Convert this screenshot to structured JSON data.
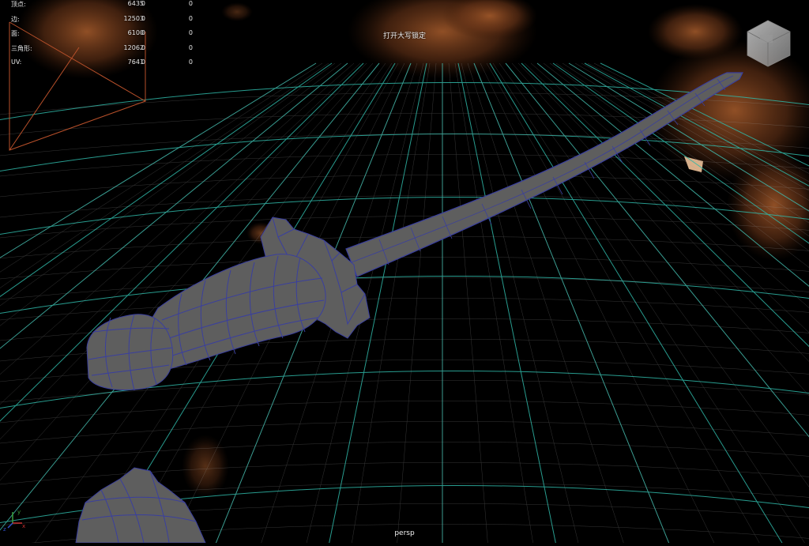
{
  "hud": {
    "rows": [
      {
        "label": "顶点:",
        "value": "6435",
        "selected": "0",
        "component": "0"
      },
      {
        "label": "边:",
        "value": "12503",
        "selected": "0",
        "component": "0"
      },
      {
        "label": "面:",
        "value": "6100",
        "selected": "0",
        "component": "0"
      },
      {
        "label": "三角形:",
        "value": "12062",
        "selected": "0",
        "component": "0"
      },
      {
        "label": "UV:",
        "value": "7641",
        "selected": "0",
        "component": "0"
      }
    ]
  },
  "viewport": {
    "message": "打开大写锁定",
    "camera_label": "persp",
    "axis_labels": {
      "x": "x",
      "y": "y",
      "z": "z"
    },
    "colors": {
      "grid": "#2fb8a8",
      "mesh_fill": "#5e5e5e",
      "wireframe": "#3a3f9e",
      "background": "#000000",
      "bark": "#8a4a22"
    }
  },
  "view_cube": {
    "icon": "view-cube-icon"
  }
}
